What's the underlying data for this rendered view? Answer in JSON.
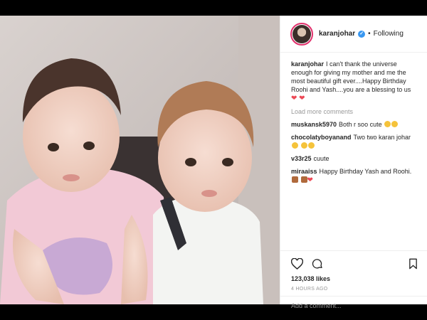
{
  "post": {
    "username": "karanjohar",
    "verified_glyph": "✓",
    "follow_separator": "•",
    "follow_status": "Following"
  },
  "caption": {
    "username": "karanjohar",
    "text": "I can't thank the universe enough for giving my mother and me the most beautiful gift ever....Happy Birthday Roohi and Yash....you are a blessing to us",
    "emoji_hearts": "❤ ❤"
  },
  "load_more": "Load more comments",
  "comments": [
    {
      "user": "muskansk5970",
      "text": "Both r soo cute",
      "emoji": [
        "kissing-face-emoji",
        "kissing-face-emoji"
      ]
    },
    {
      "user": "chocolatyboyanand",
      "text": "Two two karan johar",
      "emoji": [
        "smiling-face-emoji",
        "smiling-face-emoji",
        "smiling-face-emoji"
      ]
    },
    {
      "user": "v33r25",
      "text": "cuute",
      "emoji": []
    },
    {
      "user": "miraaiss",
      "text": "Happy Birthday Yash and Roohi.",
      "emoji": [
        "cake-emoji",
        "cake-emoji",
        "heart-emoji"
      ]
    }
  ],
  "likes": "123,038 likes",
  "timestamp": "4 HOURS AGO",
  "add_comment_placeholder": "Add a comment...",
  "icons": {
    "like": "heart-outline-icon",
    "comment": "speech-bubble-icon",
    "save": "bookmark-icon"
  },
  "colors": {
    "verified": "#3897f0",
    "heart": "#ed4956",
    "avatar_ring": "#e1306c"
  }
}
